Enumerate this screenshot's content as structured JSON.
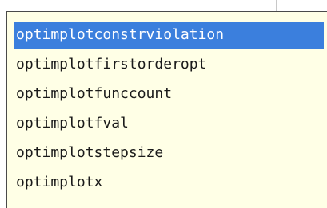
{
  "autocomplete": {
    "items": [
      {
        "label": "optimplotconstrviolation",
        "selected": true
      },
      {
        "label": "optimplotfirstorderopt",
        "selected": false
      },
      {
        "label": "optimplotfunccount",
        "selected": false
      },
      {
        "label": "optimplotfval",
        "selected": false
      },
      {
        "label": "optimplotstepsize",
        "selected": false
      },
      {
        "label": "optimplotx",
        "selected": false
      }
    ]
  },
  "colors": {
    "popup_background": "#ffffe6",
    "selection_background": "#3b7fdd",
    "selection_text": "#ffffff",
    "text": "#1a1a1a"
  }
}
